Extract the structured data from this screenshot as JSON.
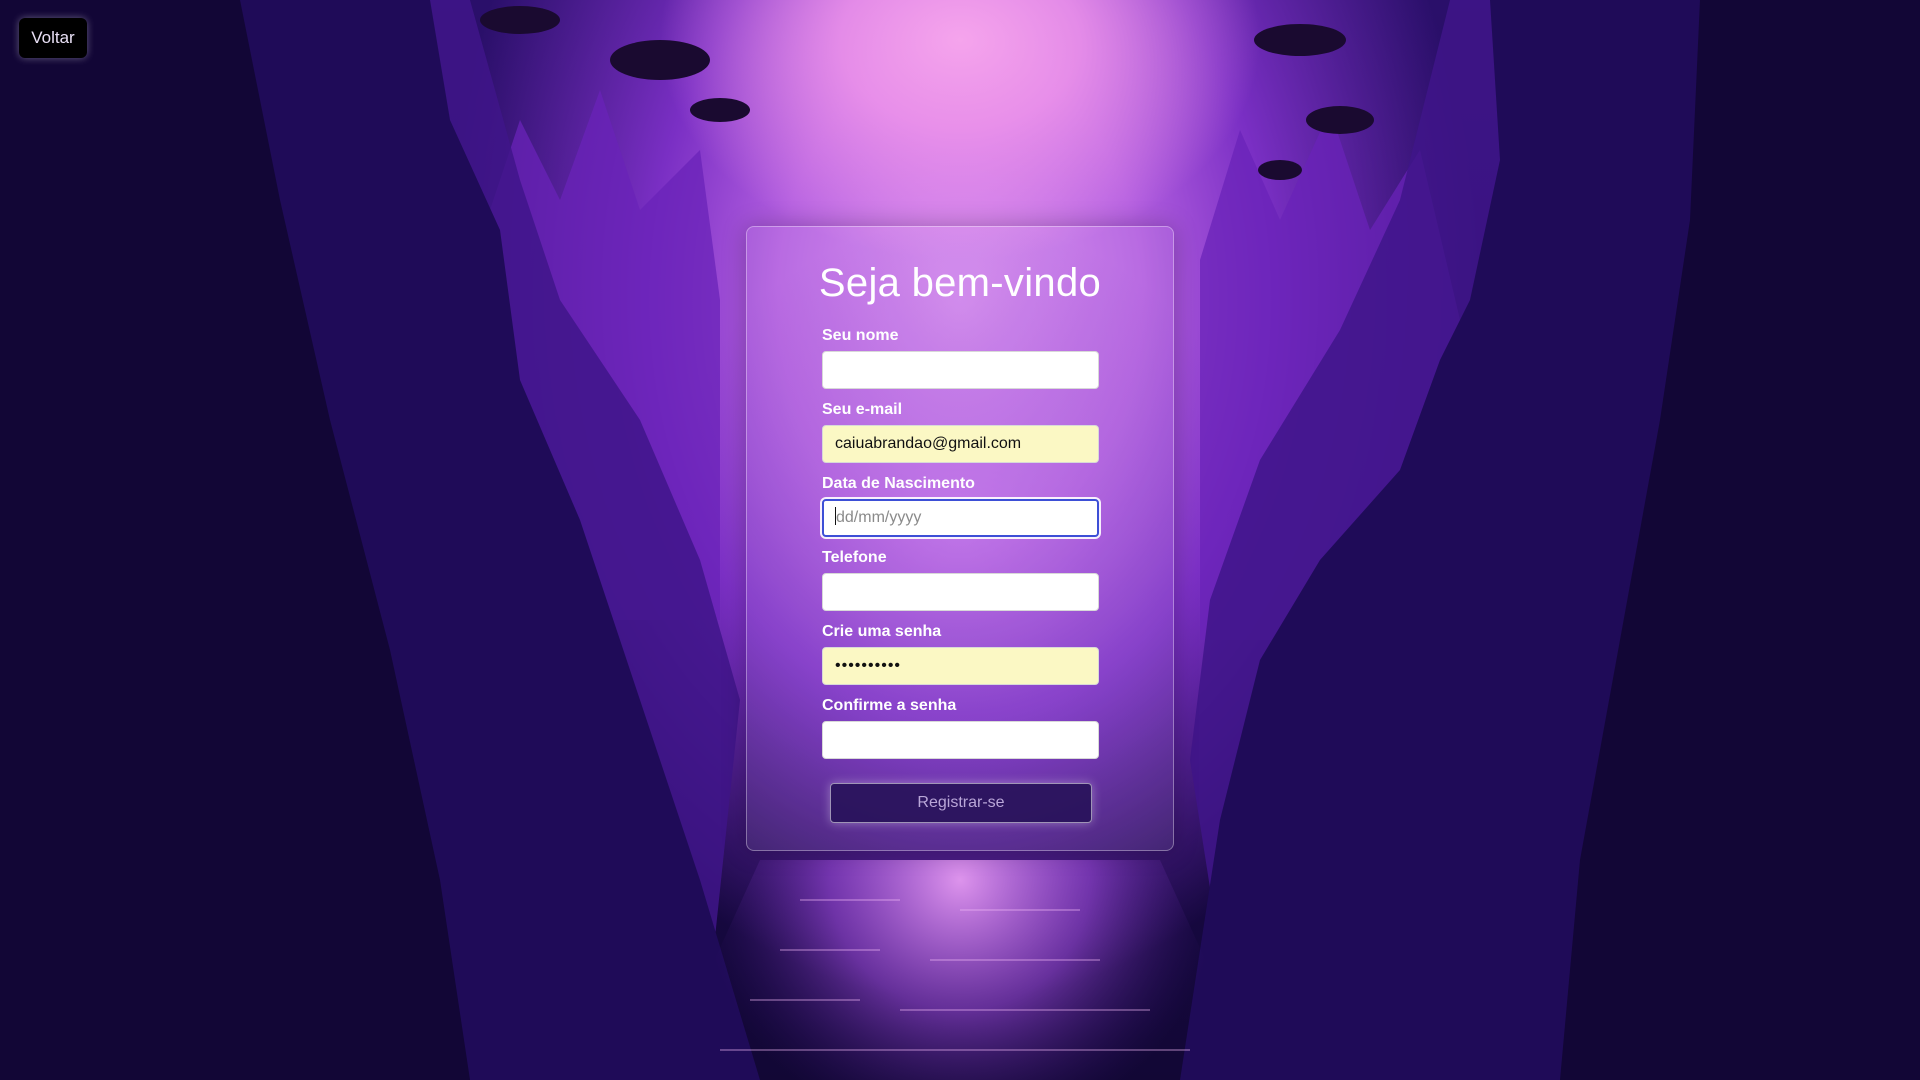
{
  "header": {
    "back_label": "Voltar"
  },
  "form": {
    "title": "Seja bem-vindo",
    "fields": [
      {
        "label": "Seu nome",
        "value": "",
        "placeholder": ""
      },
      {
        "label": "Seu e-mail",
        "value": "caiuabrandao@gmail.com",
        "placeholder": ""
      },
      {
        "label": "Data de Nascimento",
        "value": "",
        "placeholder": "dd/mm/yyyy"
      },
      {
        "label": "Telefone",
        "value": "",
        "placeholder": ""
      },
      {
        "label": "Crie uma senha",
        "value": "••••••••••",
        "placeholder": ""
      },
      {
        "label": "Confirme a senha",
        "value": "",
        "placeholder": ""
      }
    ],
    "submit_label": "Registrar-se"
  },
  "colors": {
    "autofill_background": "#fbf8c4",
    "focus_border": "#3d4fd6",
    "sky_glow": "#f5a4ec",
    "scene_dark": "#1e0a55"
  }
}
